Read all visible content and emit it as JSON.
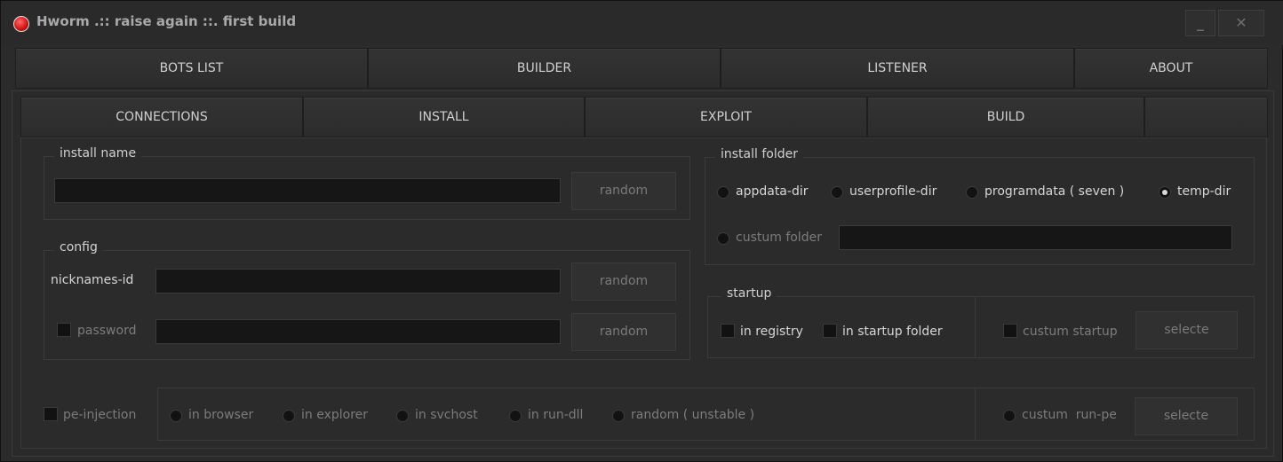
{
  "window": {
    "title": "Hworm .:: raise again ::. first build",
    "minimize": "_",
    "close": "✕"
  },
  "main_tabs": [
    "BOTS LIST",
    "BUILDER",
    "LISTENER",
    "ABOUT"
  ],
  "sub_tabs": [
    "CONNECTIONS",
    "INSTALL",
    "EXPLOIT",
    "BUILD"
  ],
  "install_name": {
    "legend": "install name",
    "value": "",
    "random": "random"
  },
  "config": {
    "legend": "config",
    "nick_label": "nicknames-id",
    "nick_value": "",
    "nick_random": "random",
    "password_label": "password",
    "password_value": "",
    "password_random": "random",
    "password_checked": false
  },
  "install_folder": {
    "legend": "install folder",
    "options": [
      "appdata-dir",
      "userprofile-dir",
      "programdata ( seven )",
      "temp-dir"
    ],
    "selected": "temp-dir",
    "custom_label": "custum folder",
    "custom_value": ""
  },
  "startup": {
    "legend": "startup",
    "registry": "in registry",
    "startup_folder": "in startup folder",
    "custom": "custum startup",
    "select": "selecte"
  },
  "injection": {
    "label": "pe-injection",
    "options": [
      "in browser",
      "in explorer",
      "in svchost",
      "in run-dll",
      "random ( unstable )"
    ],
    "custom": "custum  run-pe",
    "select": "selecte"
  },
  "colors": {
    "background": "#2b2b2b",
    "field": "#161616",
    "text": "#d0d0d0",
    "disabled_text": "#7a7a7a",
    "icon_red": "#d01010"
  }
}
